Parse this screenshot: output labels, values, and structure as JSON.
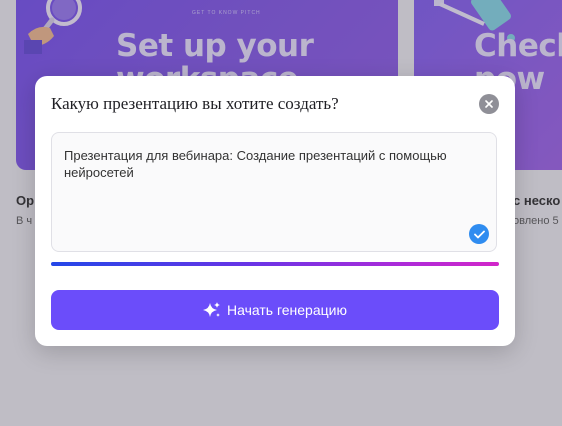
{
  "background": {
    "cards": [
      {
        "headline": "Set up your\nworkspace",
        "small_text": "GET TO KNOW PITCH",
        "title": "Ор",
        "meta": "В ч"
      },
      {
        "headline": "Check\npow",
        "title": "с неско",
        "meta": "овлено 5"
      }
    ]
  },
  "modal": {
    "title": "Какую презентацию вы хотите создать?",
    "close_icon": "close-icon",
    "prompt_text": "Презентация для вебинара: Создание презентаций с помощью нейросетей",
    "check_icon": "checkmark-icon",
    "progress": 1.0,
    "generate_button": {
      "label": "Начать генерацию",
      "icon": "sparkles-icon"
    }
  },
  "colors": {
    "accent": "#6b4dfa",
    "check": "#2f8cf0",
    "progress_start": "#2447e8",
    "progress_end": "#d226c9"
  }
}
